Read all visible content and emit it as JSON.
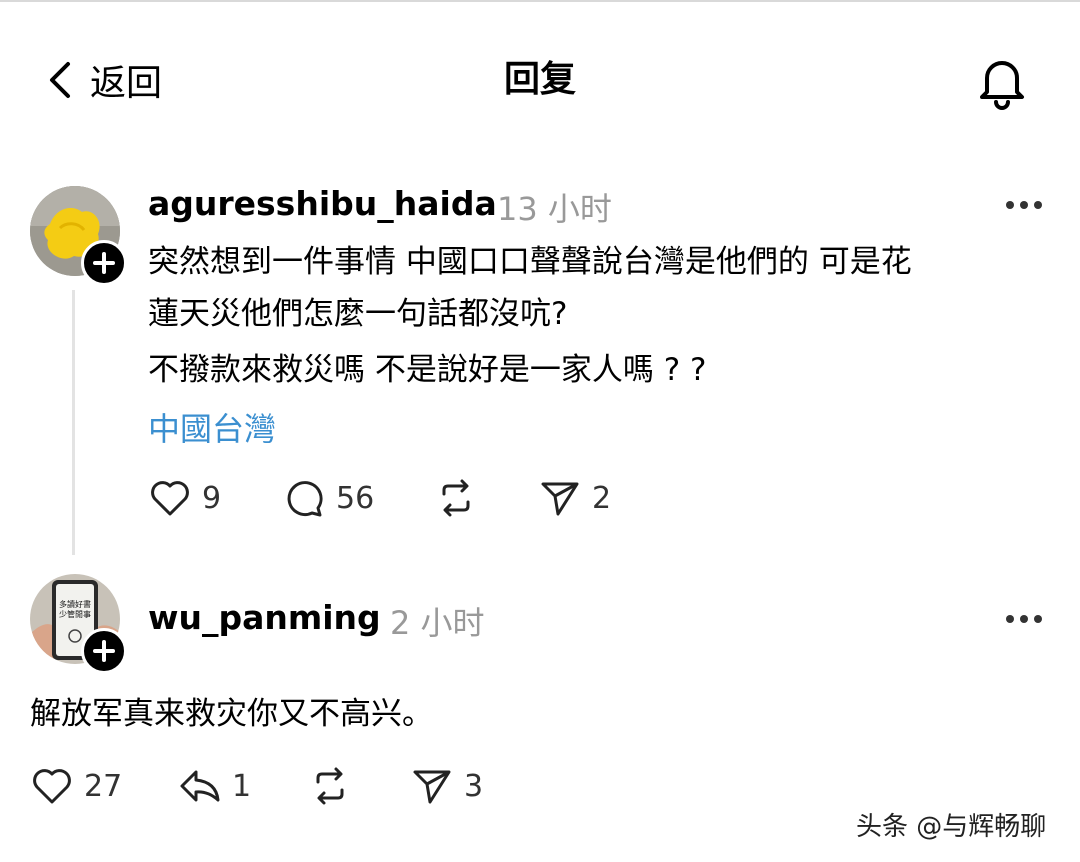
{
  "header": {
    "back_label": "返回",
    "title": "回复"
  },
  "post1": {
    "username": "aguresshibu_haida",
    "time": "13 小时",
    "lines": [
      "突然想到一件事情 中國口口聲聲說台灣是他們的 可是花",
      "蓮天災他們怎麼一句話都沒吭?",
      "不撥款來救災嗎 不是說好是一家人嗎 ? ?"
    ],
    "tag": "中國台灣",
    "actions": {
      "likes": "9",
      "comments": "56",
      "shares": "2"
    }
  },
  "post2": {
    "username": "wu_panming",
    "time": "2 小时",
    "avatar_lines": [
      "多讀好書",
      "少管閒事"
    ],
    "text": "解放军真来救灾你又不高兴。",
    "actions": {
      "likes": "27",
      "replies": "1",
      "shares": "3"
    }
  },
  "watermark": "头条 @与辉畅聊"
}
